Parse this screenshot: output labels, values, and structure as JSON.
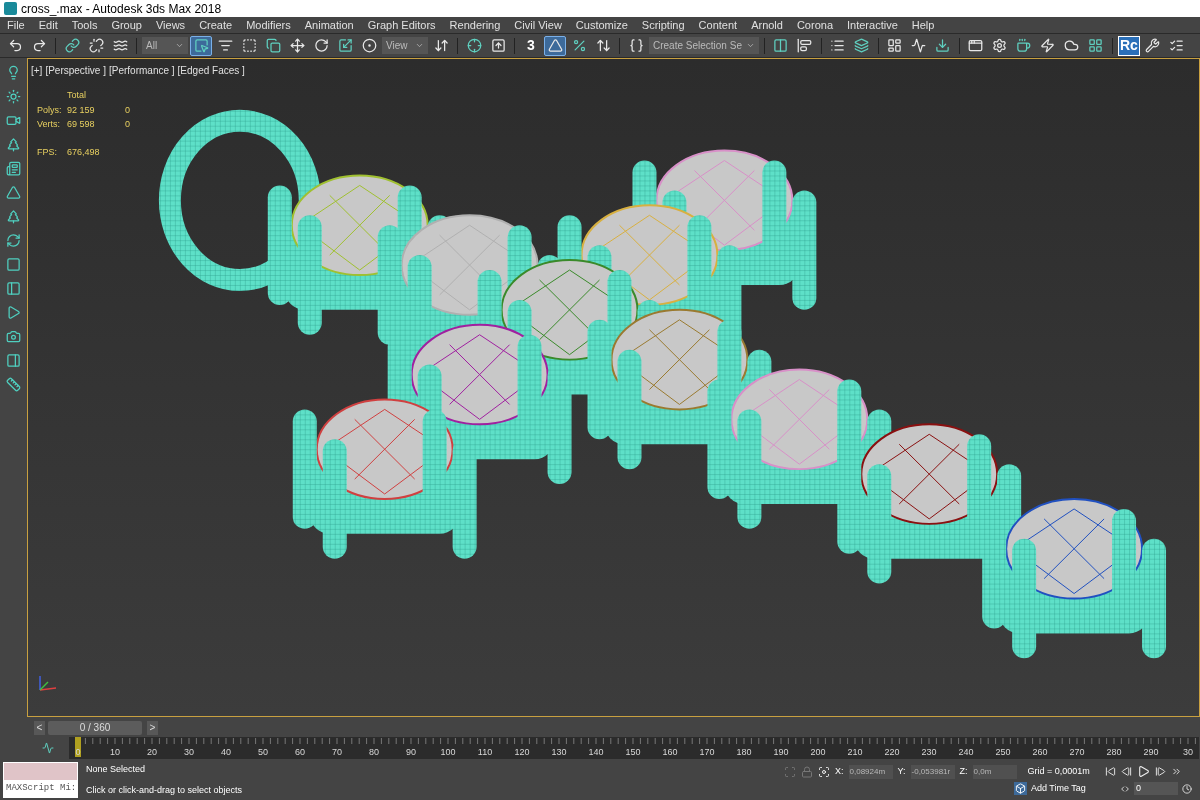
{
  "window": {
    "title": "cross_.max - Autodesk 3ds Max 2018"
  },
  "menu": [
    "File",
    "Edit",
    "Tools",
    "Group",
    "Views",
    "Create",
    "Modifiers",
    "Animation",
    "Graph Editors",
    "Rendering",
    "Civil View",
    "Customize",
    "Scripting",
    "Content",
    "Arnold",
    "Corona",
    "Interactive",
    "Help"
  ],
  "toolbar": [
    {
      "kind": "button",
      "selected": false
    },
    {
      "kind": "button",
      "selected": false
    },
    {
      "kind": "separator"
    },
    {
      "kind": "button",
      "selected": false
    },
    {
      "kind": "button",
      "selected": false
    },
    {
      "kind": "button",
      "selected": false
    },
    {
      "kind": "separator"
    },
    {
      "kind": "dropdown",
      "value": "All"
    },
    {
      "kind": "button",
      "selected": true
    },
    {
      "kind": "button",
      "selected": false
    },
    {
      "kind": "button",
      "selected": false
    },
    {
      "kind": "button",
      "selected": false
    },
    {
      "kind": "button",
      "selected": false
    },
    {
      "kind": "button",
      "selected": false
    },
    {
      "kind": "button",
      "selected": false
    },
    {
      "kind": "button",
      "selected": false
    },
    {
      "kind": "dropdown",
      "value": "View"
    },
    {
      "kind": "button",
      "selected": false
    },
    {
      "kind": "separator"
    },
    {
      "kind": "button",
      "selected": false
    },
    {
      "kind": "button",
      "selected": false
    },
    {
      "kind": "separator"
    },
    {
      "kind": "label",
      "label": "3",
      "selected": false
    },
    {
      "kind": "button",
      "selected": true
    },
    {
      "kind": "button",
      "selected": false
    },
    {
      "kind": "button",
      "selected": false
    },
    {
      "kind": "separator"
    },
    {
      "kind": "button",
      "selected": false
    },
    {
      "kind": "dropdown",
      "value": "Create Selection Se"
    },
    {
      "kind": "separator"
    },
    {
      "kind": "button",
      "selected": false
    },
    {
      "kind": "button",
      "selected": false
    },
    {
      "kind": "separator"
    },
    {
      "kind": "button",
      "selected": false
    },
    {
      "kind": "button",
      "selected": false
    },
    {
      "kind": "separator"
    },
    {
      "kind": "button",
      "selected": false
    },
    {
      "kind": "button",
      "selected": false
    },
    {
      "kind": "button",
      "selected": false
    },
    {
      "kind": "separator"
    },
    {
      "kind": "button",
      "selected": false
    },
    {
      "kind": "button",
      "selected": false
    },
    {
      "kind": "button",
      "selected": false
    },
    {
      "kind": "button",
      "selected": false
    },
    {
      "kind": "button",
      "selected": false
    },
    {
      "kind": "button",
      "selected": false
    },
    {
      "kind": "separator"
    },
    {
      "kind": "label",
      "label": "Rc",
      "selected": false
    },
    {
      "kind": "button",
      "selected": false
    },
    {
      "kind": "button",
      "selected": false
    }
  ],
  "viewport": {
    "labels": [
      "[+]",
      "[Perspective ]",
      "[Performance ]",
      "[Edged Faces ]"
    ],
    "stats": {
      "header": "Total",
      "rows": [
        {
          "label": "Polys:",
          "total": "92 159",
          "selected": "0"
        },
        {
          "label": "Verts:",
          "total": "69 598",
          "selected": "0"
        }
      ],
      "fps_label": "FPS:",
      "fps": "676,498"
    }
  },
  "timeline": {
    "prev": "<",
    "position": "0 / 360",
    "next": ">",
    "level": 0,
    "ticks": [
      "0",
      "10",
      "20",
      "30",
      "40",
      "50",
      "60",
      "70",
      "80",
      "90",
      "100",
      "110",
      "120",
      "130",
      "140",
      "150",
      "160",
      "170",
      "180",
      "190",
      "200",
      "210",
      "220",
      "230",
      "240",
      "250",
      "260",
      "270",
      "280",
      "290",
      "30"
    ]
  },
  "status": {
    "selection": "None Selected",
    "prompt": "Click or click-and-drag to select objects",
    "listener": "MAXScript Mi:",
    "coords": [
      {
        "axis": "X:",
        "value": "0,08924m"
      },
      {
        "axis": "Y:",
        "value": "-0,053981r"
      },
      {
        "axis": "Z:",
        "value": "0,0m"
      }
    ],
    "grid": "Grid = 0,0001m",
    "time_tag": "Add Time Tag",
    "frame": "0"
  }
}
